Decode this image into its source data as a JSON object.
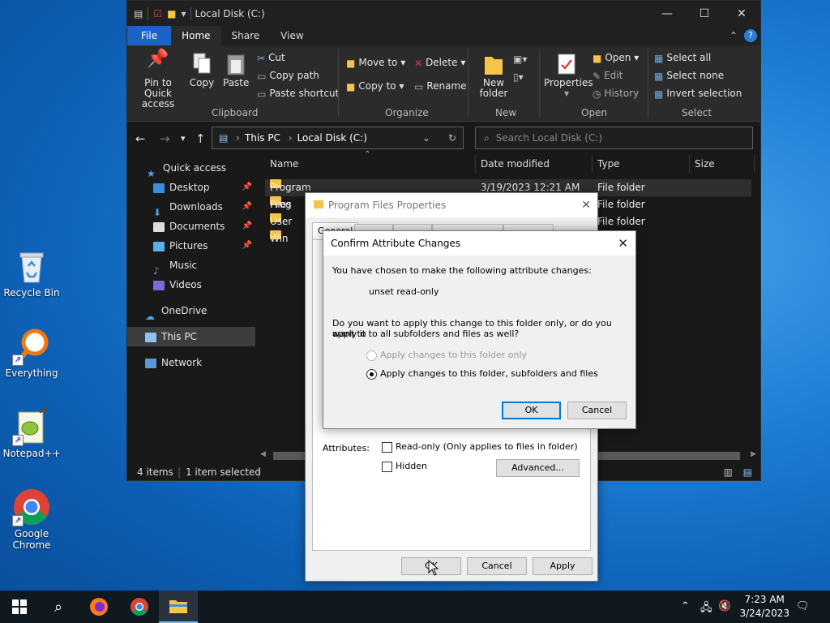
{
  "desktop": {
    "icons": [
      {
        "label": "Recycle Bin"
      },
      {
        "label": "Everything"
      },
      {
        "label": "Notepad++"
      },
      {
        "label": "Google Chrome"
      }
    ]
  },
  "explorer": {
    "title": "Local Disk (C:)",
    "menu_tabs": {
      "file": "File",
      "home": "Home",
      "share": "Share",
      "view": "View"
    },
    "help": "?",
    "ribbon": {
      "clipboard": {
        "pin": "Pin to Quick access",
        "copy": "Copy",
        "paste": "Paste",
        "cut": "Cut",
        "copy_path": "Copy path",
        "paste_shortcut": "Paste shortcut",
        "label": "Clipboard"
      },
      "organize": {
        "move_to": "Move to",
        "copy_to": "Copy to",
        "delete": "Delete",
        "rename": "Rename",
        "label": "Organize"
      },
      "new": {
        "new_folder": "New folder",
        "label": "New"
      },
      "open": {
        "properties": "Properties",
        "open": "Open",
        "edit": "Edit",
        "history": "History",
        "label": "Open"
      },
      "select": {
        "select_all": "Select all",
        "select_none": "Select none",
        "invert": "Invert selection",
        "label": "Select"
      }
    },
    "address": {
      "this_pc": "This PC",
      "local_disk": "Local Disk (C:)"
    },
    "search_placeholder": "Search Local Disk (C:)",
    "nav": {
      "quick_access": "Quick access",
      "desktop": "Desktop",
      "downloads": "Downloads",
      "documents": "Documents",
      "pictures": "Pictures",
      "music": "Music",
      "videos": "Videos",
      "onedrive": "OneDrive",
      "this_pc": "This PC",
      "network": "Network"
    },
    "columns": {
      "name": "Name",
      "date": "Date modified",
      "type": "Type",
      "size": "Size"
    },
    "files": [
      {
        "name": "Program Files",
        "date": "3/19/2023 12:21 AM",
        "type": "File folder"
      },
      {
        "name": "Prog",
        "date": "",
        "type": "File folder"
      },
      {
        "name": "User",
        "date": "",
        "type": "File folder"
      },
      {
        "name": "Win",
        "date": "",
        "type": ""
      }
    ],
    "status": {
      "items": "4 items",
      "selected": "1 item selected"
    }
  },
  "properties": {
    "title": "Program Files Properties",
    "tab_general": "General",
    "attributes_label": "Attributes:",
    "readonly": "Read-only (Only applies to files in folder)",
    "hidden": "Hidden",
    "advanced": "Advanced...",
    "ok": "OK",
    "cancel": "Cancel",
    "apply": "Apply"
  },
  "confirm": {
    "title": "Confirm Attribute Changes",
    "intro": "You have chosen to make the following attribute changes:",
    "change": "unset read-only",
    "question_line1": "Do you want to apply this change to this folder only, or do you want to",
    "question_line2": "apply it to all subfolders and files as well?",
    "option1": "Apply changes to this folder only",
    "option2": "Apply changes to this folder, subfolders and files",
    "ok": "OK",
    "cancel": "Cancel"
  },
  "taskbar": {
    "time": "7:23 AM",
    "date": "3/24/2023"
  },
  "colors": {
    "accent": "#0078d7",
    "file_tab": "#1c63c7",
    "folder": "#f5c44a"
  }
}
